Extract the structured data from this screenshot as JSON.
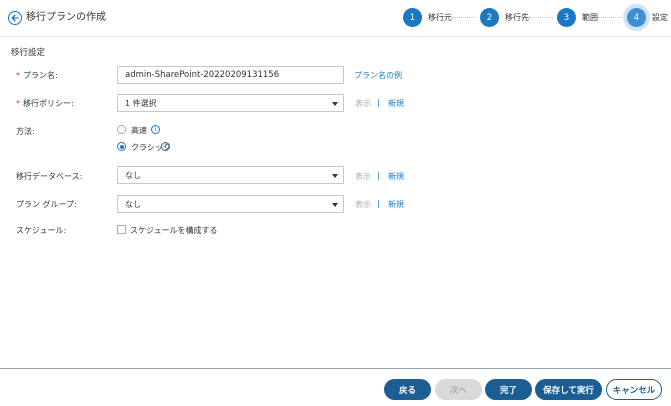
{
  "header": {
    "title": "移行プランの作成",
    "steps": [
      {
        "number": "1",
        "label": "移行元"
      },
      {
        "number": "2",
        "label": "移行先"
      },
      {
        "number": "3",
        "label": "範囲"
      },
      {
        "number": "4",
        "label": "設定"
      }
    ]
  },
  "section_title": "移行設定",
  "form": {
    "plan_name": {
      "label": "プラン名:",
      "value": "admin-SharePoint-20220209131156",
      "example_link": "プラン名の例"
    },
    "policy": {
      "label": "移行ポリシー:",
      "value": "1 件選択",
      "view_link": "表示",
      "separator": "|",
      "new_link": "新規"
    },
    "method": {
      "label": "方法:",
      "options": [
        {
          "label": "高速",
          "selected": false
        },
        {
          "label": "クラシック",
          "selected": true
        }
      ],
      "info_glyph": "i"
    },
    "database": {
      "label": "移行データベース:",
      "value": "なし",
      "view_link": "表示",
      "separator": "|",
      "new_link": "新規"
    },
    "plan_group": {
      "label": "プラン グループ:",
      "value": "なし",
      "view_link": "表示",
      "separator": "|",
      "new_link": "新規"
    },
    "schedule": {
      "label": "スケジュール:",
      "checkbox_label": "スケジュールを構成する",
      "checked": false
    }
  },
  "footer": {
    "back": "戻る",
    "next": "次へ",
    "finish": "完了",
    "save_run": "保存して実行",
    "cancel": "キャンセル"
  },
  "colors": {
    "accent": "#1a78c2",
    "primary_button": "#1c5e93",
    "required": "#d9363e"
  }
}
